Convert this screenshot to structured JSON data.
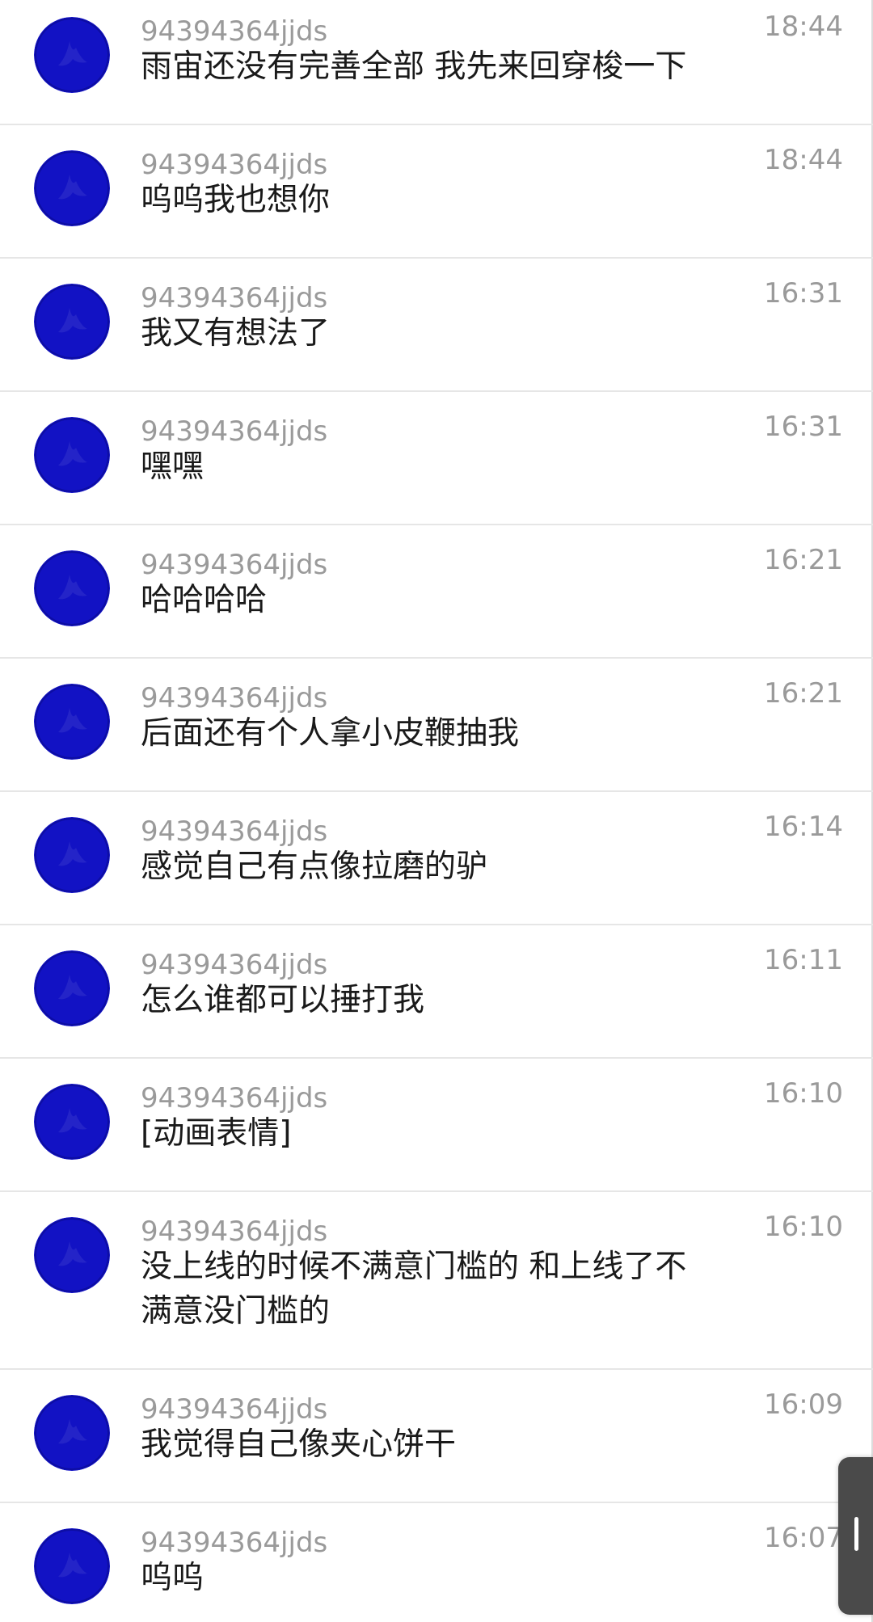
{
  "theme": {
    "avatar_color": "#1212c4",
    "avatar_edge": "#0a0a8a",
    "sender_color": "#9a9a9a",
    "text_color": "#1a1a1a",
    "divider_color": "#e6e6e6",
    "scroll_handle_color": "#4a4a4a"
  },
  "messages": [
    {
      "sender": "94394364jjds",
      "time": "18:44",
      "text": "雨宙还没有完善全部 我先来回穿梭一下",
      "avatar": "avatar-icon"
    },
    {
      "sender": "94394364jjds",
      "time": "18:44",
      "text": "呜呜我也想你",
      "avatar": "avatar-icon"
    },
    {
      "sender": "94394364jjds",
      "time": "16:31",
      "text": "我又有想法了",
      "avatar": "avatar-icon"
    },
    {
      "sender": "94394364jjds",
      "time": "16:31",
      "text": "嘿嘿",
      "avatar": "avatar-icon"
    },
    {
      "sender": "94394364jjds",
      "time": "16:21",
      "text": "哈哈哈哈",
      "avatar": "avatar-icon"
    },
    {
      "sender": "94394364jjds",
      "time": "16:21",
      "text": "后面还有个人拿小皮鞭抽我",
      "avatar": "avatar-icon"
    },
    {
      "sender": "94394364jjds",
      "time": "16:14",
      "text": "感觉自己有点像拉磨的驴",
      "avatar": "avatar-icon"
    },
    {
      "sender": "94394364jjds",
      "time": "16:11",
      "text": "怎么谁都可以捶打我",
      "avatar": "avatar-icon"
    },
    {
      "sender": "94394364jjds",
      "time": "16:10",
      "text": "[动画表情]",
      "avatar": "avatar-icon"
    },
    {
      "sender": "94394364jjds",
      "time": "16:10",
      "text": "没上线的时候不满意门槛的 和上线了不\n满意没门槛的",
      "avatar": "avatar-icon"
    },
    {
      "sender": "94394364jjds",
      "time": "16:09",
      "text": "我觉得自己像夹心饼干",
      "avatar": "avatar-icon"
    },
    {
      "sender": "94394364jjds",
      "time": "16:07",
      "text": "呜呜",
      "avatar": "avatar-icon"
    }
  ]
}
